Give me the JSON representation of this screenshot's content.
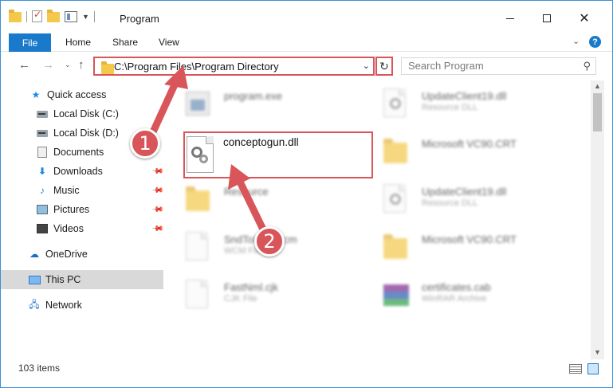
{
  "window": {
    "title": "Program",
    "controls": {
      "minimize": "minimize",
      "maximize": "maximize",
      "close": "✕"
    }
  },
  "ribbon": {
    "tabs": [
      "File",
      "Home",
      "Share",
      "View"
    ],
    "help": "?"
  },
  "nav": {
    "address": "C:\\Program Files\\Program Directory",
    "search_placeholder": "Search Program"
  },
  "sidebar": {
    "items": [
      {
        "label": "Quick access",
        "icon": "star-icon",
        "pinned": false
      },
      {
        "label": "Local Disk (C:)",
        "icon": "disk-icon",
        "pinned": false
      },
      {
        "label": "Local Disk (D:)",
        "icon": "disk-icon",
        "pinned": false
      },
      {
        "label": "Documents",
        "icon": "documents-icon",
        "pinned": false
      },
      {
        "label": "Downloads",
        "icon": "download-icon",
        "pinned": true
      },
      {
        "label": "Music",
        "icon": "music-icon",
        "pinned": true
      },
      {
        "label": "Pictures",
        "icon": "pictures-icon",
        "pinned": true
      },
      {
        "label": "Videos",
        "icon": "videos-icon",
        "pinned": true
      },
      {
        "label": "OneDrive",
        "icon": "cloud-icon",
        "pinned": false
      },
      {
        "label": "This PC",
        "icon": "pc-icon",
        "pinned": false,
        "selected": true
      },
      {
        "label": "Network",
        "icon": "network-icon",
        "pinned": false
      }
    ]
  },
  "files": [
    {
      "name": "program.exe",
      "sub": "",
      "icon": "exe-icon"
    },
    {
      "name": "UpdateClient19.dll",
      "sub": "Resource DLL",
      "icon": "dll-icon"
    },
    {
      "name": "Microsoft VC90.CRT",
      "sub": "",
      "icon": "folder-icon"
    },
    {
      "name": "Resource",
      "sub": "",
      "icon": "folder-icon"
    },
    {
      "name": "UpdateClient19.dll",
      "sub": "Resource DLL",
      "icon": "dll-icon"
    },
    {
      "name": "SndToIcon.wcm",
      "sub": "WCM File",
      "icon": "file-icon"
    },
    {
      "name": "Microsoft VC90.CRT",
      "sub": "",
      "icon": "folder-icon"
    },
    {
      "name": "FastNml.cjk",
      "sub": "CJK File",
      "icon": "file-icon"
    },
    {
      "name": "certificates.cab",
      "sub": "WinRAR Archive",
      "icon": "rar-icon"
    }
  ],
  "highlighted_file": {
    "name": "conceptogun.dll",
    "icon": "dll-icon"
  },
  "annotations": {
    "step1": "1",
    "step2": "2"
  },
  "status": {
    "items_count": "103 items"
  },
  "colors": {
    "accent": "#1979ca",
    "callout": "#d8555a"
  }
}
